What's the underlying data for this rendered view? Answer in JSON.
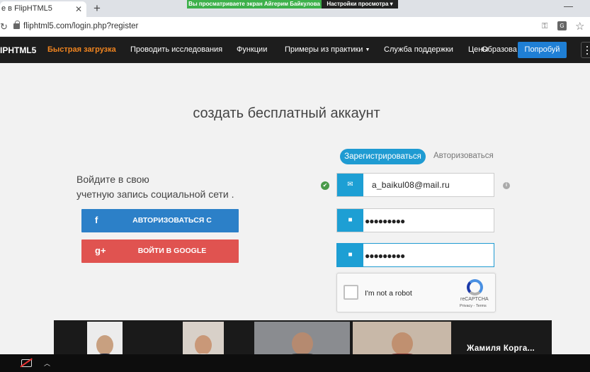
{
  "browser": {
    "tab_title": "е в FlipHTML5",
    "tab_close": "✕",
    "new_tab": "+",
    "minimize": "—",
    "url": "fliphtml5.com/login.php?register",
    "share_notice": "Вы просматриваете экран Айгерим Байкулова",
    "share_settings": "Настройки просмотра ▾"
  },
  "site_nav": {
    "logo": "IPHTML5",
    "quick_upload": "Быстрая загрузка",
    "links": [
      "Проводить исследования",
      "Функции",
      "Примеры из практики",
      "Служба поддержки",
      "Цены"
    ],
    "overlay_link": "Образова",
    "try_button": "Попробуй"
  },
  "main": {
    "title": "создать бесплатный аккаунт",
    "social_prompt_line1": "Войдите в свою",
    "social_prompt_line2": "учетную запись социальной сети .",
    "facebook_icon": "f",
    "facebook_button": "АВТОРИЗОВАТЬСЯ С",
    "google_icon": "g+",
    "google_button": "ВОЙТИ В GOOGLE",
    "tab_register": "Зарегистрироваться",
    "tab_login": "Авторизоваться",
    "email_value": "a_baikul08@mail.ru",
    "password_mask": "●●●●●●●●●",
    "confirm_mask": "●●●●●●●●●",
    "captcha_label": "I'm not a robot",
    "captcha_brand": "reCAPTCHA",
    "captcha_terms": "Privacy - Terms"
  },
  "call": {
    "caller_name": "Жамиля  Корга..."
  },
  "colors": {
    "accent_blue": "#1f9bd2",
    "facebook": "#2c80c8",
    "google": "#e05350",
    "nav_bg": "#1d1d1d",
    "quick_upload": "#f0841f"
  }
}
